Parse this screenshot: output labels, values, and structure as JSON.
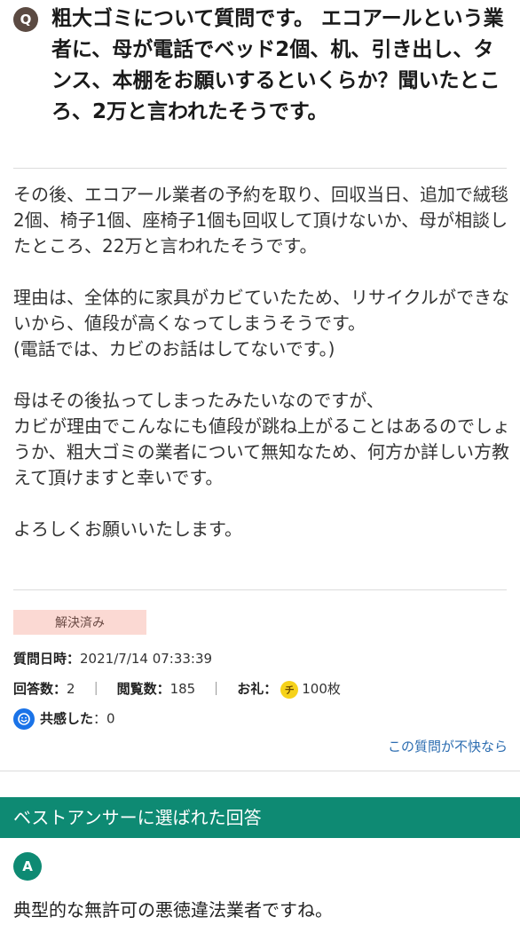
{
  "question": {
    "badge": "Q",
    "title": "粗大ゴミについて質問です。 エコアールという業者に、母が電話でベッド2個、机、引き出し、タンス、本棚をお願いするといくらか？聞いたところ、2万と言われたそうです。",
    "body": "その後、エコアール業者の予約を取り、回収当日、追加で絨毯2個、椅子1個、座椅子1個も回収して頂けないか、母が相談したところ、22万と言われたそうです。\n\n理由は、全体的に家具がカビていたため、リサイクルができないから、値段が高くなってしまうそうです。\n(電話では、カビのお話はしてないです。)\n\n母はその後払ってしまったみたいなのですが、\nカビが理由でこんなにも値段が跳ね上がることはあるのでしょうか、粗大ゴミの業者について無知なため、何方か詳しい方教えて頂けますと幸いです。\n\nよろしくお願いいたします。"
  },
  "status": {
    "solved_label": "解決済み"
  },
  "meta": {
    "date_label": "質問日時：",
    "date_value": "2021/7/14 07:33:39",
    "answers_label": "回答数：",
    "answers_value": "2",
    "views_label": "閲覧数：",
    "views_value": "185",
    "reward_label": "お礼：",
    "coin_glyph": "チ",
    "reward_value": "100枚",
    "empathy_label": "共感した",
    "empathy_value": "：0",
    "separator": "｜"
  },
  "report_link": "この質問が不快なら",
  "best_answer": {
    "header": "ベストアンサーに選ばれた回答",
    "badge": "A",
    "text": "典型的な無許可の悪徳違法業者ですね。"
  },
  "colors": {
    "accent_green": "#0e8a73",
    "link_blue": "#2b6cb0",
    "solved_bg": "#fbd9d3"
  }
}
